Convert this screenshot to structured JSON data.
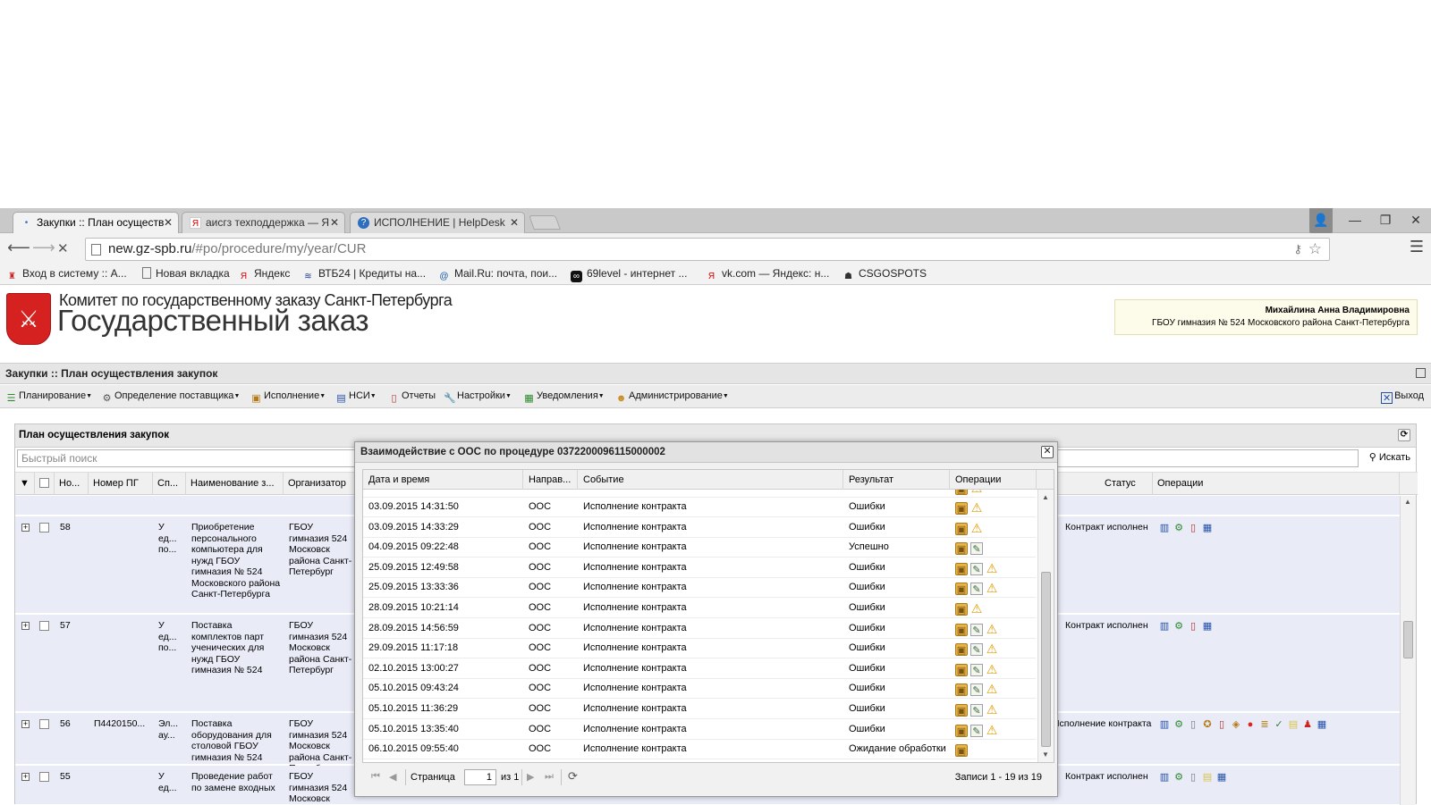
{
  "browser": {
    "tabs": [
      {
        "title": "Закупки :: План осуществ",
        "icon": "loading-dot"
      },
      {
        "title": "аисгз техподдержка — Я",
        "icon": "yandex-icon"
      },
      {
        "title": "ИСПОЛНЕНИЕ | HelpDesk",
        "icon": "helpdesk-icon"
      }
    ],
    "url_host": "new.gz-spb.ru",
    "url_path": "/#po/procedure/my/year/CUR",
    "bookmarks": [
      "Вход в систему :: А...",
      "Новая вкладка",
      "Яндекс",
      "ВТБ24 | Кредиты на...",
      "Mail.Ru: почта, пои...",
      "69level - интернет ...",
      "vk.com — Яндекс: н...",
      "CSGOSPOTS"
    ]
  },
  "header": {
    "org_sub": "Комитет по государственному заказу Санкт-Петербурга",
    "org_main": "Государственный заказ",
    "user_name": "Михайлина Анна Владимировна",
    "user_org": "ГБОУ гимназия № 524 Московского района Санкт-Петербурга"
  },
  "app": {
    "title": "Закупки :: План осуществления закупок",
    "menu": [
      {
        "label": "Планирование",
        "icon": "planning-icon"
      },
      {
        "label": "Определение поставщика",
        "icon": "gears-icon"
      },
      {
        "label": "Исполнение",
        "icon": "execution-icon"
      },
      {
        "label": "НСИ",
        "icon": "book-icon"
      },
      {
        "label": "Отчеты",
        "icon": "report-icon"
      },
      {
        "label": "Настройки",
        "icon": "wrench-icon"
      },
      {
        "label": "Уведомления",
        "icon": "notification-icon"
      },
      {
        "label": "Администрирование",
        "icon": "admin-icon"
      }
    ],
    "logout": "Выход"
  },
  "panel": {
    "title": "План осуществления закупок",
    "search_placeholder": "Быстрый поиск",
    "search_button": "Искать",
    "columns": [
      "Но...",
      "Номер ПГ",
      "Сп...",
      "Наименование з...",
      "Организатор",
      "Статус",
      "Операции"
    ],
    "rows": [
      {
        "num": "58",
        "pg": "",
        "sp": "У ед... по...",
        "name": "Приобретение персонального компьютера для нужд ГБОУ гимназия № 524 Московского района Санкт-Петербурга",
        "org": "ГБОУ гимназия 524 Московск района Санкт-Петербург",
        "status": "Контракт исполнен"
      },
      {
        "num": "57",
        "pg": "",
        "sp": "У ед... по...",
        "name": "Поставка комплектов парт ученических для нужд ГБОУ гимназия № 524",
        "org": "ГБОУ гимназия 524 Московск района Санкт-Петербург",
        "status": "Контракт исполнен"
      },
      {
        "num": "56",
        "pg": "П4420150...",
        "sp": "Эл... ау...",
        "name": "Поставка оборудования для столовой ГБОУ гимназия № 524",
        "org": "ГБОУ гимназия 524 Московск района Санкт-Петербург",
        "status": "Исполнение контракта"
      },
      {
        "num": "55",
        "pg": "",
        "sp": "У ед...",
        "name": "Проведение работ по замене входных",
        "org": "ГБОУ гимназия 524 Московск",
        "status": "Контракт исполнен"
      }
    ]
  },
  "modal": {
    "title": "Взаимодействие с ООС по процедуре 0372200096115000002",
    "columns": [
      "Дата и время",
      "Направ...",
      "Событие",
      "Результат",
      "Операции"
    ],
    "rows": [
      {
        "dt": "03.09.2015 14:31:50",
        "dir": "ООС",
        "event": "Исполнение контракта",
        "result": "Ошибки",
        "ops": [
          "box",
          "warn"
        ]
      },
      {
        "dt": "03.09.2015 14:33:29",
        "dir": "ООС",
        "event": "Исполнение контракта",
        "result": "Ошибки",
        "ops": [
          "box",
          "warn"
        ]
      },
      {
        "dt": "04.09.2015 09:22:48",
        "dir": "ООС",
        "event": "Исполнение контракта",
        "result": "Успешно",
        "ops": [
          "box",
          "doc"
        ]
      },
      {
        "dt": "25.09.2015 12:49:58",
        "dir": "ООС",
        "event": "Исполнение контракта",
        "result": "Ошибки",
        "ops": [
          "box",
          "doc",
          "warn"
        ]
      },
      {
        "dt": "25.09.2015 13:33:36",
        "dir": "ООС",
        "event": "Исполнение контракта",
        "result": "Ошибки",
        "ops": [
          "box",
          "doc",
          "warn"
        ]
      },
      {
        "dt": "28.09.2015 10:21:14",
        "dir": "ООС",
        "event": "Исполнение контракта",
        "result": "Ошибки",
        "ops": [
          "box",
          "warn"
        ]
      },
      {
        "dt": "28.09.2015 14:56:59",
        "dir": "ООС",
        "event": "Исполнение контракта",
        "result": "Ошибки",
        "ops": [
          "box",
          "doc",
          "warn"
        ]
      },
      {
        "dt": "29.09.2015 11:17:18",
        "dir": "ООС",
        "event": "Исполнение контракта",
        "result": "Ошибки",
        "ops": [
          "box",
          "doc",
          "warn"
        ]
      },
      {
        "dt": "02.10.2015 13:00:27",
        "dir": "ООС",
        "event": "Исполнение контракта",
        "result": "Ошибки",
        "ops": [
          "box",
          "doc",
          "warn"
        ]
      },
      {
        "dt": "05.10.2015 09:43:24",
        "dir": "ООС",
        "event": "Исполнение контракта",
        "result": "Ошибки",
        "ops": [
          "box",
          "doc",
          "warn"
        ]
      },
      {
        "dt": "05.10.2015 11:36:29",
        "dir": "ООС",
        "event": "Исполнение контракта",
        "result": "Ошибки",
        "ops": [
          "box",
          "doc",
          "warn"
        ]
      },
      {
        "dt": "05.10.2015 13:35:40",
        "dir": "ООС",
        "event": "Исполнение контракта",
        "result": "Ошибки",
        "ops": [
          "box",
          "doc",
          "warn"
        ]
      },
      {
        "dt": "06.10.2015 09:55:40",
        "dir": "ООС",
        "event": "Исполнение контракта",
        "result": "Ожидание обработки",
        "ops": [
          "box"
        ]
      }
    ],
    "pager": {
      "page_label": "Страница",
      "page": "1",
      "of_label": "из 1",
      "summary": "Записи 1 - 19 из 19"
    }
  }
}
